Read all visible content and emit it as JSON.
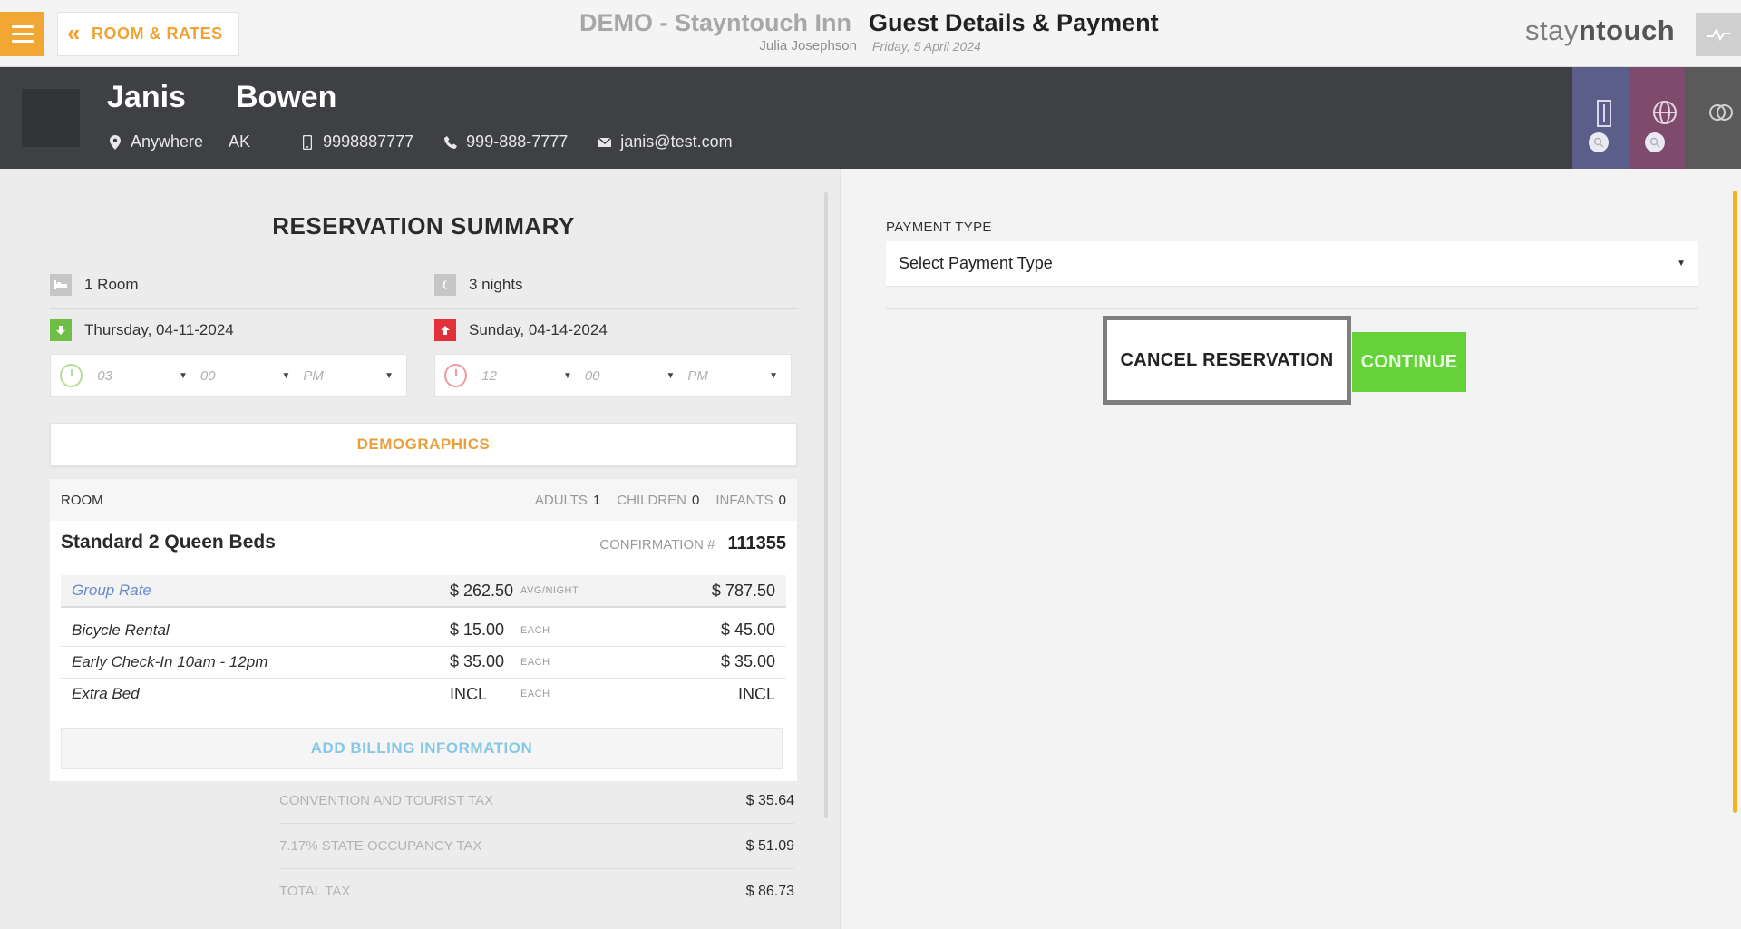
{
  "topbar": {
    "back_label": "ROOM & RATES",
    "hotel_name": "DEMO - Stayntouch Inn",
    "user_name": "Julia Josephson",
    "page_title": "Guest Details & Payment",
    "page_date": "Friday, 5 April 2024",
    "brand_a": "stay",
    "brand_n": "n",
    "brand_b": "touch"
  },
  "guest": {
    "first_name": "Janis",
    "last_name": "Bowen",
    "city": "Anywhere",
    "state": "AK",
    "mobile": "9998887777",
    "phone": "999-888-7777",
    "email": "janis@test.com"
  },
  "summary": {
    "title": "RESERVATION SUMMARY",
    "rooms": "1 Room",
    "nights": "3 nights",
    "arrival": "Thursday, 04-11-2024",
    "departure": "Sunday, 04-14-2024",
    "arrival_time": {
      "hour": "03",
      "minute": "00",
      "ampm": "PM"
    },
    "departure_time": {
      "hour": "12",
      "minute": "00",
      "ampm": "PM"
    },
    "demographics_label": "DEMOGRAPHICS",
    "room_label": "ROOM",
    "adults_label": "ADULTS",
    "adults": "1",
    "children_label": "CHILDREN",
    "children": "0",
    "infants_label": "INFANTS",
    "infants": "0",
    "room_type": "Standard 2 Queen Beds",
    "confirmation_label": "CONFIRMATION #",
    "confirmation": "111355",
    "lines": [
      {
        "name": "Group Rate",
        "price": "$ 262.50",
        "unit": "AVG/NIGHT",
        "total": "$ 787.50"
      },
      {
        "name": "Bicycle Rental",
        "price": "$ 15.00",
        "unit": "EACH",
        "total": "$ 45.00"
      },
      {
        "name": "Early Check-In 10am - 12pm",
        "price": "$ 35.00",
        "unit": "EACH",
        "total": "$ 35.00"
      },
      {
        "name": "Extra Bed",
        "price": "INCL",
        "unit": "EACH",
        "total": "INCL"
      }
    ],
    "add_billing_label": "ADD BILLING INFORMATION",
    "taxes": [
      {
        "label": "CONVENTION AND TOURIST TAX",
        "amount": "$ 35.64"
      },
      {
        "label": "7.17% STATE OCCUPANCY TAX",
        "amount": "$ 51.09"
      },
      {
        "label": "TOTAL TAX",
        "amount": "$ 86.73"
      }
    ]
  },
  "payment": {
    "label": "PAYMENT TYPE",
    "placeholder": "Select Payment Type",
    "cancel_label": "CANCEL RESERVATION",
    "continue_label": "CONTINUE"
  },
  "colors": {
    "accent": "#f2a634",
    "header_bg": "#3e4044",
    "continue": "#66d23a",
    "arrival": "#6fbf46",
    "departure": "#e2313b"
  }
}
